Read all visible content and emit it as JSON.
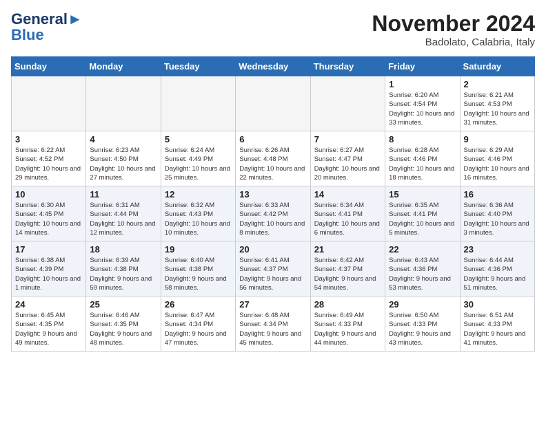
{
  "logo": {
    "line1": "General",
    "line2": "Blue"
  },
  "title": "November 2024",
  "location": "Badolato, Calabria, Italy",
  "days_of_week": [
    "Sunday",
    "Monday",
    "Tuesday",
    "Wednesday",
    "Thursday",
    "Friday",
    "Saturday"
  ],
  "weeks": [
    [
      {
        "day": "",
        "text": "",
        "empty": true
      },
      {
        "day": "",
        "text": "",
        "empty": true
      },
      {
        "day": "",
        "text": "",
        "empty": true
      },
      {
        "day": "",
        "text": "",
        "empty": true
      },
      {
        "day": "",
        "text": "",
        "empty": true
      },
      {
        "day": "1",
        "text": "Sunrise: 6:20 AM\nSunset: 4:54 PM\nDaylight: 10 hours and 33 minutes."
      },
      {
        "day": "2",
        "text": "Sunrise: 6:21 AM\nSunset: 4:53 PM\nDaylight: 10 hours and 31 minutes."
      }
    ],
    [
      {
        "day": "3",
        "text": "Sunrise: 6:22 AM\nSunset: 4:52 PM\nDaylight: 10 hours and 29 minutes."
      },
      {
        "day": "4",
        "text": "Sunrise: 6:23 AM\nSunset: 4:50 PM\nDaylight: 10 hours and 27 minutes."
      },
      {
        "day": "5",
        "text": "Sunrise: 6:24 AM\nSunset: 4:49 PM\nDaylight: 10 hours and 25 minutes."
      },
      {
        "day": "6",
        "text": "Sunrise: 6:26 AM\nSunset: 4:48 PM\nDaylight: 10 hours and 22 minutes."
      },
      {
        "day": "7",
        "text": "Sunrise: 6:27 AM\nSunset: 4:47 PM\nDaylight: 10 hours and 20 minutes."
      },
      {
        "day": "8",
        "text": "Sunrise: 6:28 AM\nSunset: 4:46 PM\nDaylight: 10 hours and 18 minutes."
      },
      {
        "day": "9",
        "text": "Sunrise: 6:29 AM\nSunset: 4:46 PM\nDaylight: 10 hours and 16 minutes."
      }
    ],
    [
      {
        "day": "10",
        "text": "Sunrise: 6:30 AM\nSunset: 4:45 PM\nDaylight: 10 hours and 14 minutes."
      },
      {
        "day": "11",
        "text": "Sunrise: 6:31 AM\nSunset: 4:44 PM\nDaylight: 10 hours and 12 minutes."
      },
      {
        "day": "12",
        "text": "Sunrise: 6:32 AM\nSunset: 4:43 PM\nDaylight: 10 hours and 10 minutes."
      },
      {
        "day": "13",
        "text": "Sunrise: 6:33 AM\nSunset: 4:42 PM\nDaylight: 10 hours and 8 minutes."
      },
      {
        "day": "14",
        "text": "Sunrise: 6:34 AM\nSunset: 4:41 PM\nDaylight: 10 hours and 6 minutes."
      },
      {
        "day": "15",
        "text": "Sunrise: 6:35 AM\nSunset: 4:41 PM\nDaylight: 10 hours and 5 minutes."
      },
      {
        "day": "16",
        "text": "Sunrise: 6:36 AM\nSunset: 4:40 PM\nDaylight: 10 hours and 3 minutes."
      }
    ],
    [
      {
        "day": "17",
        "text": "Sunrise: 6:38 AM\nSunset: 4:39 PM\nDaylight: 10 hours and 1 minute."
      },
      {
        "day": "18",
        "text": "Sunrise: 6:39 AM\nSunset: 4:38 PM\nDaylight: 9 hours and 59 minutes."
      },
      {
        "day": "19",
        "text": "Sunrise: 6:40 AM\nSunset: 4:38 PM\nDaylight: 9 hours and 58 minutes."
      },
      {
        "day": "20",
        "text": "Sunrise: 6:41 AM\nSunset: 4:37 PM\nDaylight: 9 hours and 56 minutes."
      },
      {
        "day": "21",
        "text": "Sunrise: 6:42 AM\nSunset: 4:37 PM\nDaylight: 9 hours and 54 minutes."
      },
      {
        "day": "22",
        "text": "Sunrise: 6:43 AM\nSunset: 4:36 PM\nDaylight: 9 hours and 53 minutes."
      },
      {
        "day": "23",
        "text": "Sunrise: 6:44 AM\nSunset: 4:36 PM\nDaylight: 9 hours and 51 minutes."
      }
    ],
    [
      {
        "day": "24",
        "text": "Sunrise: 6:45 AM\nSunset: 4:35 PM\nDaylight: 9 hours and 49 minutes."
      },
      {
        "day": "25",
        "text": "Sunrise: 6:46 AM\nSunset: 4:35 PM\nDaylight: 9 hours and 48 minutes."
      },
      {
        "day": "26",
        "text": "Sunrise: 6:47 AM\nSunset: 4:34 PM\nDaylight: 9 hours and 47 minutes."
      },
      {
        "day": "27",
        "text": "Sunrise: 6:48 AM\nSunset: 4:34 PM\nDaylight: 9 hours and 45 minutes."
      },
      {
        "day": "28",
        "text": "Sunrise: 6:49 AM\nSunset: 4:33 PM\nDaylight: 9 hours and 44 minutes."
      },
      {
        "day": "29",
        "text": "Sunrise: 6:50 AM\nSunset: 4:33 PM\nDaylight: 9 hours and 43 minutes."
      },
      {
        "day": "30",
        "text": "Sunrise: 6:51 AM\nSunset: 4:33 PM\nDaylight: 9 hours and 41 minutes."
      }
    ]
  ]
}
